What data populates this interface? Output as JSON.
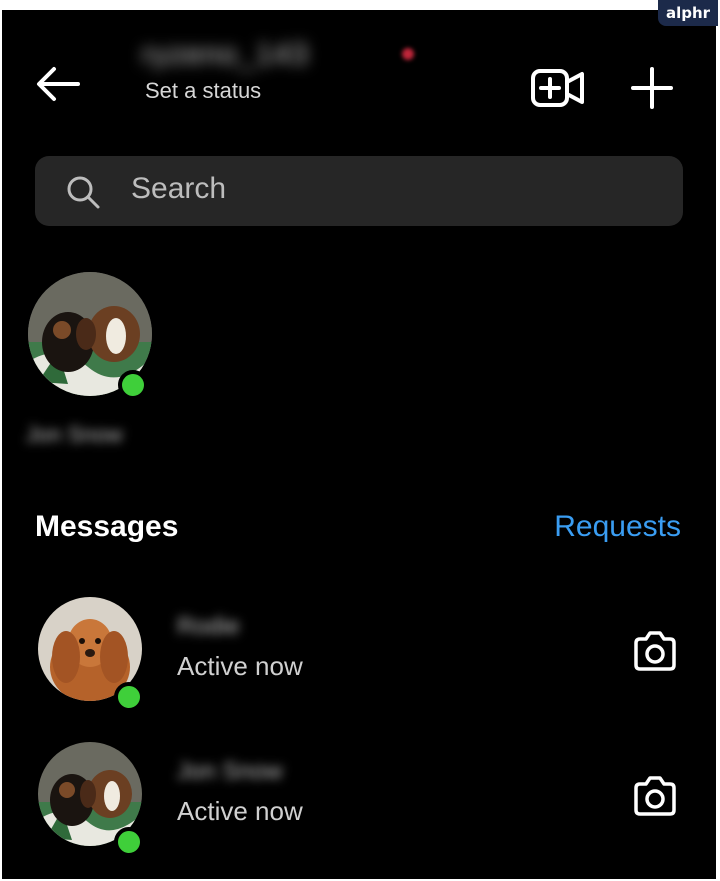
{
  "watermark": "alphr",
  "header": {
    "username": "ryzeno_143",
    "status_link": "Set a status",
    "back_icon": "arrow-left-icon",
    "video_icon": "video-call-add-icon",
    "new_icon": "plus-icon"
  },
  "search": {
    "placeholder": "Search"
  },
  "active_contacts": [
    {
      "name": "Jon Snow",
      "online": true
    }
  ],
  "messages": {
    "title": "Messages",
    "requests_label": "Requests",
    "rows": [
      {
        "name": "Rodie",
        "status": "Active now",
        "online": true
      },
      {
        "name": "Jon Snow",
        "status": "Active now",
        "online": true
      }
    ]
  },
  "colors": {
    "background": "#000000",
    "accent": "#3a9df2",
    "online": "#3fcf3a",
    "search_bg": "#262626"
  }
}
